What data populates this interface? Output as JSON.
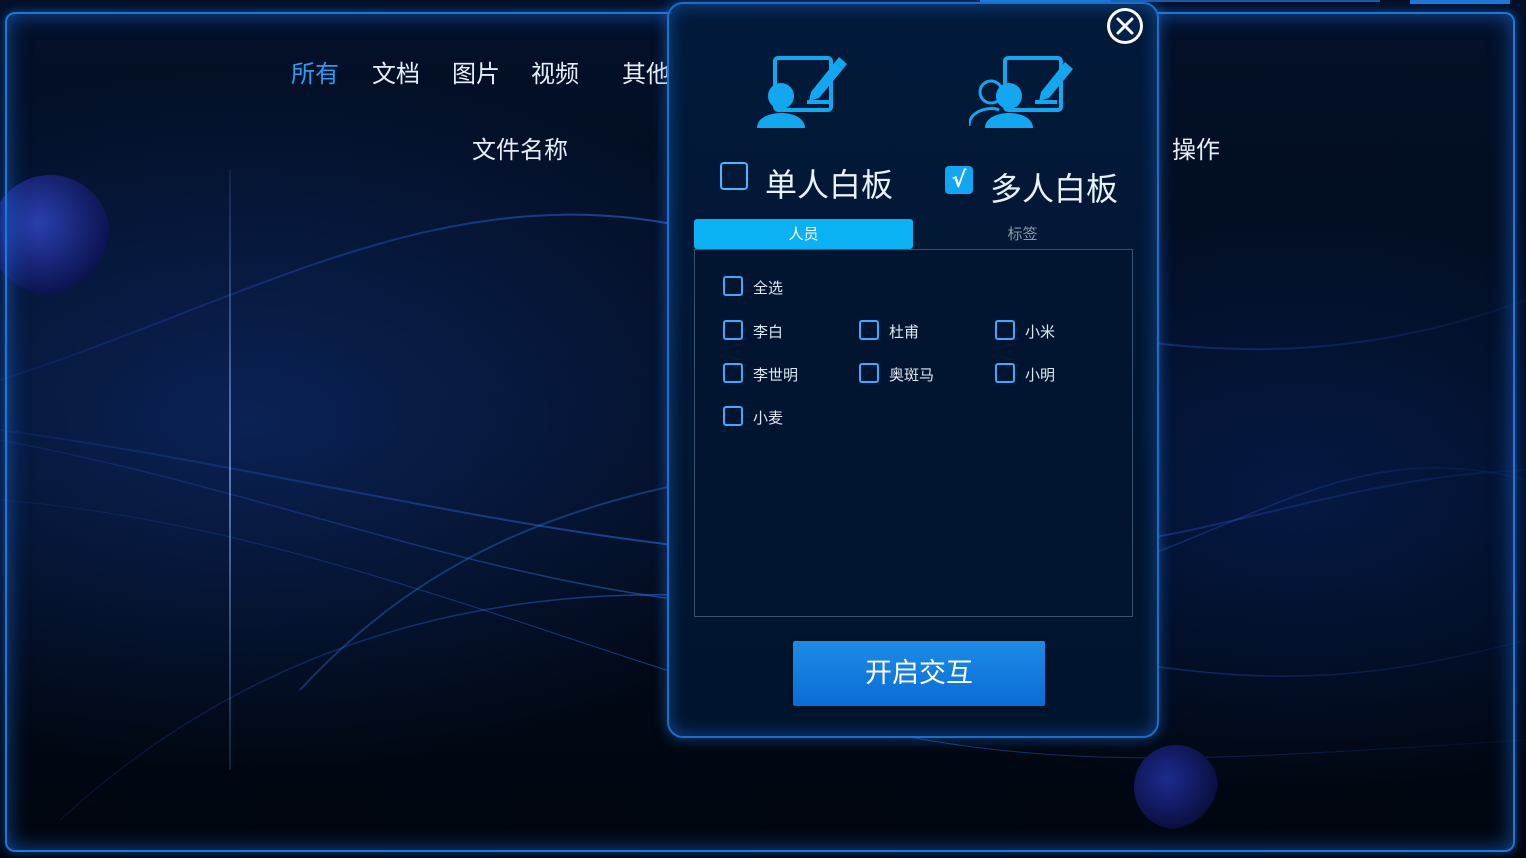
{
  "background": {
    "category_tabs": [
      {
        "label": "所有",
        "active": true
      },
      {
        "label": "文档",
        "active": false
      },
      {
        "label": "图片",
        "active": false
      },
      {
        "label": "视频",
        "active": false
      },
      {
        "label": "其他",
        "active": false
      }
    ],
    "columns": {
      "file_name": "文件名称",
      "actions": "操作"
    }
  },
  "dialog": {
    "close_icon": "close-circle-icon",
    "modes": [
      {
        "label": "单人白板",
        "checked": false,
        "icon": "single-user-whiteboard-icon"
      },
      {
        "label": "多人白板",
        "checked": true,
        "check_mark": "√",
        "icon": "multi-user-whiteboard-icon"
      }
    ],
    "subtabs": [
      {
        "label": "人员",
        "active": true
      },
      {
        "label": "标签",
        "active": false
      }
    ],
    "select_all": "全选",
    "people": [
      "李白",
      "杜甫",
      "小米",
      "李世明",
      "奥斑马",
      "小明",
      "小麦"
    ],
    "start_button": "开启交互"
  },
  "colors": {
    "accent": "#2c9cf0",
    "checkbox_border": "#3fa9ff",
    "active_subtab": "#0ab2f4",
    "button": "#0a6cd6",
    "frame": "#1b78d8"
  }
}
